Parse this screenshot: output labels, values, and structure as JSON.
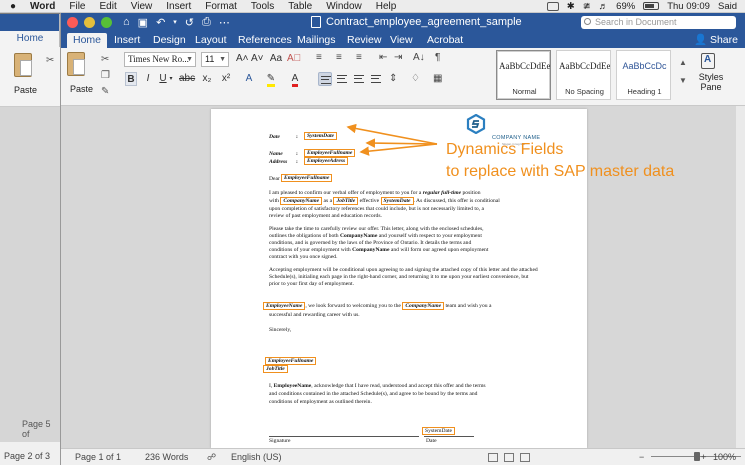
{
  "menubar": {
    "app": "Word",
    "items": [
      "File",
      "Edit",
      "View",
      "Insert",
      "Format",
      "Tools",
      "Table",
      "Window",
      "Help"
    ],
    "battery": "69%",
    "clock": "Thu 09:09",
    "user": "Said"
  },
  "bg_window": {
    "tab": "Home",
    "paste": "Paste",
    "page_label": "Page 5 of",
    "status": "Page 2 of 3"
  },
  "window": {
    "title": "Contract_employee_agreement_sample",
    "search_placeholder": "Search in Document",
    "tabs": [
      "Home",
      "Insert",
      "Design",
      "Layout",
      "References",
      "Mailings",
      "Review",
      "View",
      "Acrobat"
    ],
    "active_tab": "Home",
    "share": "Share"
  },
  "ribbon": {
    "paste": "Paste",
    "font": "Times New Ro...",
    "size": "11",
    "styles": [
      {
        "sample": "AaBbCcDdEe",
        "name": "Normal",
        "active": true
      },
      {
        "sample": "AaBbCcDdEe",
        "name": "No Spacing",
        "active": false
      },
      {
        "sample": "AaBbCcDc",
        "name": "Heading 1",
        "active": false
      }
    ],
    "styles_pane": [
      "Styles",
      "Pane"
    ]
  },
  "document": {
    "company_name": "COMPANY NAME",
    "company_tagline": "Slogan in tag line",
    "date_label": "Date",
    "date_field": "SystemDate",
    "name_label": "Name",
    "name_field": "EmployeeFullname",
    "address_label": "Address",
    "address_field": "EmployeeAdress",
    "colon": ":",
    "dear": "Dear",
    "dear_field": "EmployeeFullname",
    "p1": {
      "a": "I am pleased to confirm our verbal offer of employment to you for a",
      "b": "regular full-time",
      "c": "position",
      "with": "with",
      "company": "CompanyName",
      "as_a": "as a",
      "jobtitle": "JobTitle",
      "effective": "effective",
      "date": "SystemDate",
      "rest": ". As discussed, this offer is conditional",
      "line3": "upon completion of satisfactory references that could include, but is not necessarily limited to, a",
      "line4": "review of past employment and education records."
    },
    "p2": {
      "a": "Please take the time to carefully review our offer. This letter, along with the enclosed schedules,",
      "b": "outlines the obligations of both",
      "company": "CompanyName",
      "c": "and yourself with respect to your employment",
      "d": "conditions, and is governed by the laws of the Province of Ontario. It details the terms and",
      "e": "conditions of your employment with",
      "company2": "CompanyName",
      "f": "and will form our agreed upon employment",
      "g": "contract with you once signed."
    },
    "p3": "Accepting employment will be conditional upon agreeing to and signing the attached copy of this letter and the attached Schedule(s), initialing each page in the right-hand corner, and returning it to me upon your earliest convenience, but prior to your first day of employment.",
    "p4": {
      "name": "EmployeeName",
      "a": ", we look forward to welcoming you to the",
      "company": "CompanyName",
      "b": "team and wish you a",
      "c": "successful and rewarding career with us."
    },
    "sincerely": "Sincerely,",
    "sig_name": "EmployeeFullname",
    "sig_title": "JobTitle",
    "p5": {
      "a": "I,",
      "name": "EmployeeName",
      "b": ", acknowledge that I have read, understood and accept this offer and the terms",
      "c": "and conditions contained in the attached Schedule(s), and agree to be bound by the terms and",
      "d": "conditions of employment as outlined therein."
    },
    "bottom_date_field": "SystemDate",
    "signature_label": "Signature",
    "date_bottom_label": "Date"
  },
  "annotation": {
    "line1": "Dynamics Fields",
    "line2": "to replace with SAP master data",
    "color": "#f0901e"
  },
  "status": {
    "page": "Page 1 of 1",
    "words": "236 Words",
    "language": "English (US)",
    "zoom": "100%"
  }
}
